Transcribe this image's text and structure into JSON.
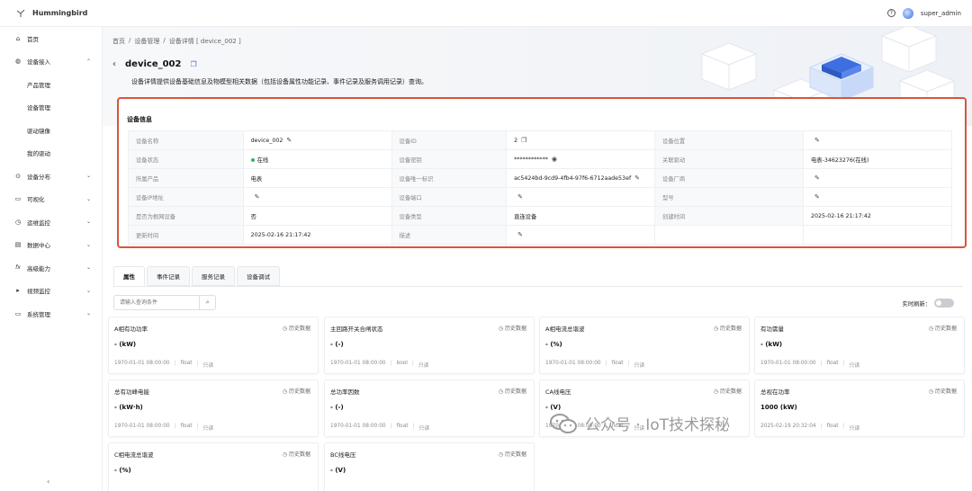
{
  "app": {
    "name": "Hummingbird",
    "user": "super_admin"
  },
  "sidebar": {
    "items": [
      {
        "label": "首页",
        "icon": "home-icon"
      },
      {
        "label": "设备接入",
        "icon": "globe-icon",
        "expanded": true
      },
      {
        "label": "产品管理",
        "sub": true
      },
      {
        "label": "设备管理",
        "sub": true
      },
      {
        "label": "驱动镜像",
        "sub": true
      },
      {
        "label": "我的驱动",
        "sub": true
      },
      {
        "label": "设备分布",
        "icon": "location-icon"
      },
      {
        "label": "可视化",
        "icon": "monitor-icon"
      },
      {
        "label": "运维监控",
        "icon": "clock-icon"
      },
      {
        "label": "数据中心",
        "icon": "data-icon"
      },
      {
        "label": "高级能力",
        "icon": "fx-icon"
      },
      {
        "label": "视频监控",
        "icon": "camera-icon"
      },
      {
        "label": "系统管理",
        "icon": "settings-icon"
      }
    ]
  },
  "breadcrumb": [
    "首页",
    "/",
    "设备管理",
    "/",
    "设备详情 [ device_002 ]"
  ],
  "page": {
    "title": "device_002",
    "description": "设备详情提供设备基础信息及物模型相关数据（包括设备属性功能记录、事件记录及服务调用记录）查询。"
  },
  "info": {
    "title": "设备信息",
    "rows": [
      [
        {
          "k": "设备名称",
          "v": "device_002",
          "edit": true
        },
        {
          "k": "设备ID",
          "v": "2",
          "copy": true
        },
        {
          "k": "设备位置",
          "v": "",
          "edit": true
        }
      ],
      [
        {
          "k": "设备状态",
          "v": "在线",
          "status": true
        },
        {
          "k": "设备密钥",
          "v": "************",
          "eye": true
        },
        {
          "k": "关联驱动",
          "v": "电表-34623276(在线)"
        }
      ],
      [
        {
          "k": "所属产品",
          "v": "电表",
          "link": true
        },
        {
          "k": "设备唯一标识",
          "v": "ac5424bd-9cd9-4fb4-97f6-6712aade53ef",
          "edit": true
        },
        {
          "k": "设备厂商",
          "v": "",
          "edit": true
        }
      ],
      [
        {
          "k": "设备IP地址",
          "v": "",
          "edit": true
        },
        {
          "k": "设备端口",
          "v": "",
          "edit": true
        },
        {
          "k": "型号",
          "v": "",
          "edit": true
        }
      ],
      [
        {
          "k": "是否为根网设备",
          "v": "否"
        },
        {
          "k": "设备类型",
          "v": "直连设备"
        },
        {
          "k": "创建时间",
          "v": "2025-02-16 21:17:42"
        }
      ],
      [
        {
          "k": "更新时间",
          "v": "2025-02-16 21:17:42"
        },
        {
          "k": "描述",
          "v": "",
          "edit": true
        },
        {
          "k": "",
          "v": ""
        }
      ]
    ]
  },
  "tabs": [
    "属性",
    "事件记录",
    "服务记录",
    "设备调试"
  ],
  "search": {
    "placeholder": "请输入查询条件"
  },
  "refresh_label": "实时刷新：",
  "history_label": "历史数据",
  "cards": [
    {
      "name": "A相有功功率",
      "value": "- (kW)",
      "time": "1970-01-01 08:00:00",
      "type": "float",
      "access": "只读"
    },
    {
      "name": "主回路开关合闸状态",
      "value": "- (-)",
      "time": "1970-01-01 08:00:00",
      "type": "bool",
      "access": "只读"
    },
    {
      "name": "A相电流总谐波",
      "value": "- (%)",
      "time": "1970-01-01 08:00:00",
      "type": "float",
      "access": "只读"
    },
    {
      "name": "有功需量",
      "value": "- (kW)",
      "time": "1970-01-01 08:00:00",
      "type": "float",
      "access": "只读"
    },
    {
      "name": "总有功峰电能",
      "value": "- (kW·h)",
      "time": "1970-01-01 08:00:00",
      "type": "float",
      "access": "只读"
    },
    {
      "name": "总功率因数",
      "value": "- (-)",
      "time": "1970-01-01 08:00:00",
      "type": "float",
      "access": "只读"
    },
    {
      "name": "CA线电压",
      "value": "- (V)",
      "time": "1970-01-01 08:00:00",
      "type": "float",
      "access": "只读"
    },
    {
      "name": "总视在功率",
      "value": "1000 (kW)",
      "time": "2025-02-19 20:32:04",
      "type": "float",
      "access": "只读"
    },
    {
      "name": "C相电流总谐波",
      "value": "- (%)",
      "time": "",
      "type": "",
      "access": ""
    },
    {
      "name": "BC线电压",
      "value": "- (V)",
      "time": "",
      "type": "",
      "access": ""
    }
  ],
  "watermark": "公众号 · IoT技术探秘"
}
